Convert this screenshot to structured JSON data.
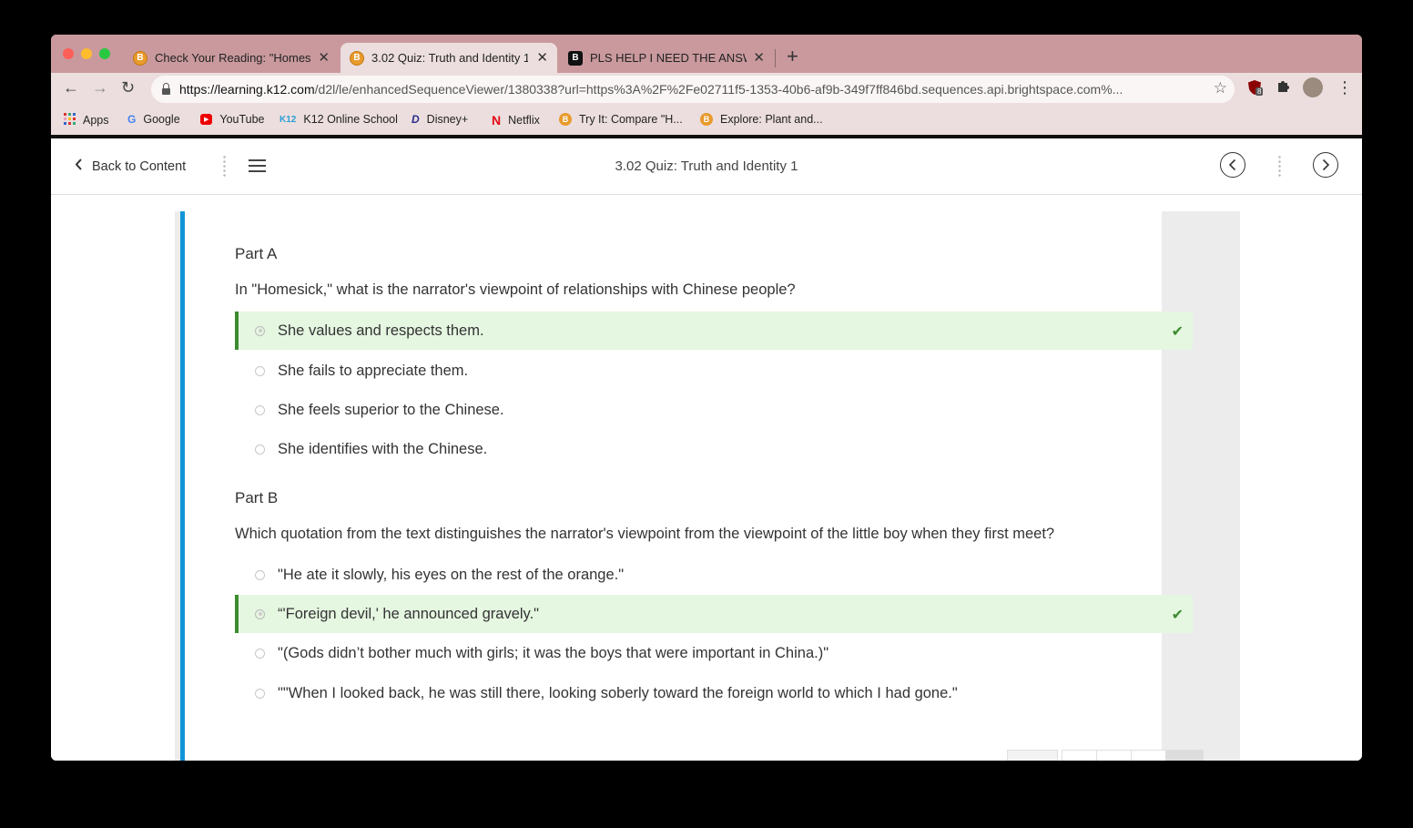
{
  "browser": {
    "tabs": [
      {
        "title": "Check Your Reading: \"Homesick\"",
        "favicon": "B"
      },
      {
        "title": "3.02 Quiz: Truth and Identity 1",
        "favicon": "B"
      },
      {
        "title": "PLS HELP I NEED THE ANSWER",
        "favicon": "B"
      }
    ],
    "new_tab": "+",
    "close": "✕",
    "url_domain": "https://learning.k12.com",
    "url_rest": "/d2l/le/enhancedSequenceViewer/1380338?url=https%3A%2F%2Fe02711f5-1353-40b6-af9b-349f7ff846bd.sequences.api.brightspace.com%...",
    "extension_badge": "8",
    "bookmarks": [
      {
        "label": "Apps",
        "icon": "apps-grid-icon"
      },
      {
        "label": "Google",
        "icon": "google-icon",
        "glyph": "G"
      },
      {
        "label": "YouTube",
        "icon": "youtube-icon",
        "glyph": "▶"
      },
      {
        "label": "K12 Online School",
        "icon": "k12-icon",
        "glyph": "K12"
      },
      {
        "label": "Disney+",
        "icon": "disney-icon",
        "glyph": "D"
      },
      {
        "label": "Netflix",
        "icon": "netflix-icon",
        "glyph": "N"
      },
      {
        "label": "Try It: Compare \"H...",
        "icon": "brightspace-icon",
        "glyph": "B"
      },
      {
        "label": "Explore: Plant and...",
        "icon": "brightspace-icon",
        "glyph": "B"
      }
    ]
  },
  "header": {
    "back_label": "Back to Content",
    "title": "3.02 Quiz: Truth and Identity 1"
  },
  "quiz": {
    "part_a": {
      "heading": "Part A",
      "question": "In \"Homesick,\" what is the narrator's viewpoint of relationships with Chinese people?",
      "options": [
        {
          "text": "She values and respects them.",
          "correct": true
        },
        {
          "text": "She fails to appreciate them.",
          "correct": false
        },
        {
          "text": "She feels superior to the Chinese.",
          "correct": false
        },
        {
          "text": "She identifies with the Chinese.",
          "correct": false
        }
      ]
    },
    "part_b": {
      "heading": "Part B",
      "question": "Which quotation from the text distinguishes the narrator's viewpoint from the viewpoint of the little boy when they first meet?",
      "options": [
        {
          "text": "\"He ate it slowly, his eyes on the rest of the orange.\"",
          "correct": false
        },
        {
          "text": "“'Foreign devil,' he announced gravely.\"",
          "correct": true
        },
        {
          "text": "\"(Gods didn’t bother much with girls; it was the boys that were important in China.)\"",
          "correct": false
        },
        {
          "text": "\"\"When I looked back, he was still there, looking soberly toward the foreign world to which I had gone.\"",
          "correct": false
        }
      ]
    },
    "check_glyph": "✔"
  },
  "colors": {
    "accent_bar": "#1095d8",
    "correct_bg": "#e5f6e1",
    "correct_border": "#3c8c2f"
  }
}
